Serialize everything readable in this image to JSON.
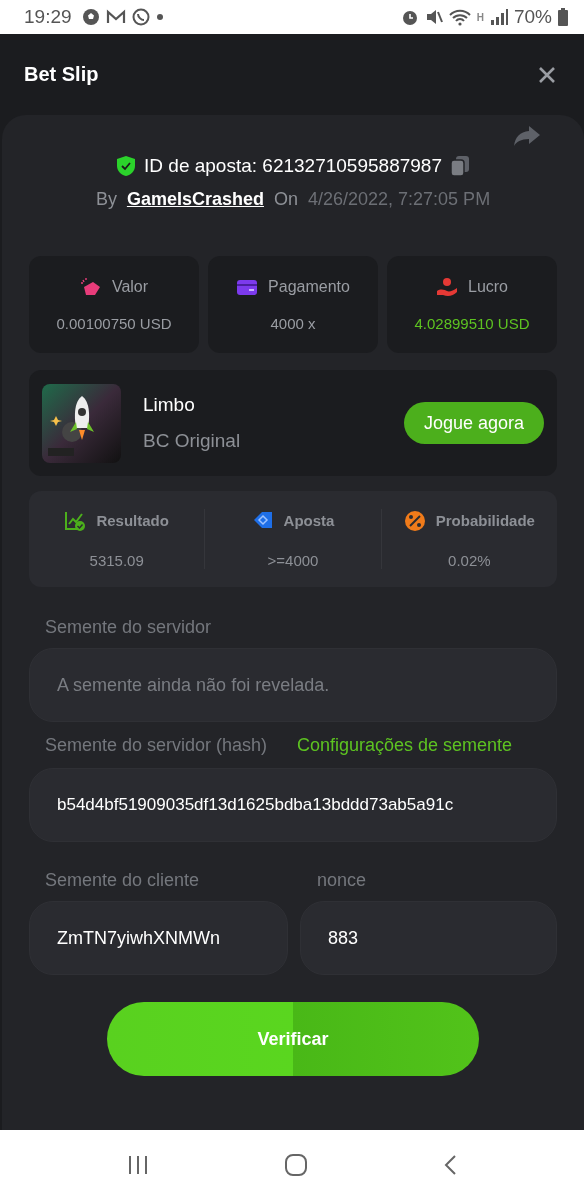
{
  "status_bar": {
    "time": "19:29",
    "network": "H",
    "battery": "70%"
  },
  "header": {
    "title": "Bet Slip"
  },
  "bet": {
    "id_label": "ID de aposta: 62132710595887987",
    "by_label": "By",
    "user": "GameIsCrashed",
    "on_label": "On",
    "date": "4/26/2022, 7:27:05 PM"
  },
  "stats": [
    {
      "kind": "amount",
      "label": "Valor",
      "value": "0.00100750 USD",
      "positive": false
    },
    {
      "kind": "payout",
      "label": "Pagamento",
      "value": "4000 x",
      "positive": false
    },
    {
      "kind": "profit",
      "label": "Lucro",
      "value": "4.02899510 USD",
      "positive": true
    }
  ],
  "game": {
    "name": "Limbo",
    "provider": "BC Original",
    "play_button": "Jogue agora"
  },
  "details": [
    {
      "kind": "result",
      "label": "Resultado",
      "value": "5315.09"
    },
    {
      "kind": "target",
      "label": "Aposta",
      "value": ">=4000"
    },
    {
      "kind": "chance",
      "label": "Probabilidade",
      "value": "0.02%"
    }
  ],
  "server_seed": {
    "label": "Semente do servidor",
    "placeholder": "A semente ainda não foi revelada."
  },
  "server_hash": {
    "label": "Semente do servidor (hash)",
    "link": "Configurações de semente",
    "value": "b54d4bf51909035df13d1625bdba13bddd73ab5a91c"
  },
  "client_seed": {
    "label": "Semente do cliente",
    "value": "ZmTN7yiwhXNMWn"
  },
  "nonce": {
    "label": "nonce",
    "value": "883"
  },
  "verify_button": "Verificar"
}
